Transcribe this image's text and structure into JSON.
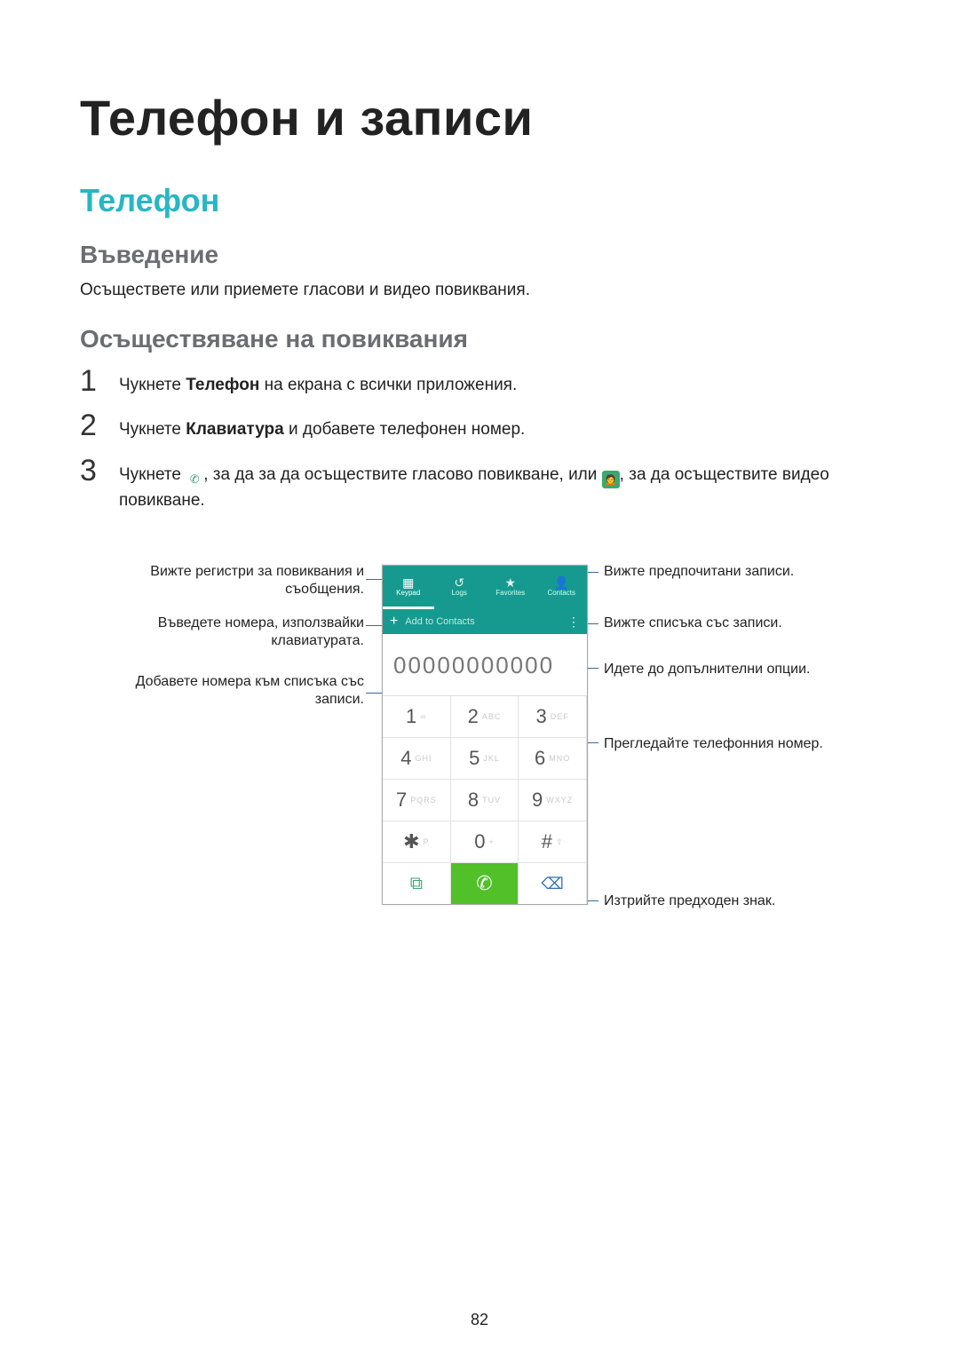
{
  "doc": {
    "title": "Телефон и записи",
    "section": "Телефон",
    "sub1": {
      "heading": "Въведение",
      "body": "Осъществете или приемете гласови и видео повиквания."
    },
    "sub2": {
      "heading": "Осъществяване на повиквания"
    },
    "steps": {
      "s1_pre": "Чукнете ",
      "s1_bold": "Телефон",
      "s1_post": " на екрана с всички приложения.",
      "s2_pre": "Чукнете ",
      "s2_bold": "Клавиатура",
      "s2_post": " и добавете телефонен номер.",
      "s3_pre": "Чукнете ",
      "s3_mid": ", за да за да осъществите гласово повикване, или ",
      "s3_post": ", за да осъществите видео повикване."
    },
    "page_number": "82"
  },
  "callouts": {
    "left1": "Вижте регистри за повиквания и съобщения.",
    "left2": "Въведете номера, използвайки клавиатурата.",
    "left3": "Добавете номера към списъка със записи.",
    "right1": "Вижте предпочитани записи.",
    "right2": "Вижте списъка със записи.",
    "right3": "Идете до допълнителни опции.",
    "right4": "Прегледайте телефонния номер.",
    "right5": "Изтрийте предходен знак."
  },
  "ui": {
    "tabs": {
      "keypad_label": "Keypad",
      "logs_label": "Logs",
      "favorites_label": "Favorites",
      "contacts_label": "Contacts"
    },
    "add_to_contacts": "Add to Contacts",
    "entered_number": "00000000000",
    "keys": {
      "k1": "1",
      "k1s": "∞",
      "k2": "2",
      "k2s": "ABC",
      "k3": "3",
      "k3s": "DEF",
      "k4": "4",
      "k4s": "GHI",
      "k5": "5",
      "k5s": "JKL",
      "k6": "6",
      "k6s": "MNO",
      "k7": "7",
      "k7s": "PQRS",
      "k8": "8",
      "k8s": "TUV",
      "k9": "9",
      "k9s": "WXYZ",
      "ks": "✱",
      "kss": "P",
      "k0": "0",
      "k0s": "+",
      "kh": "#",
      "khs": "⇧"
    }
  },
  "icons": {
    "phone_green": "green-phone-handset",
    "videocall_green": "green-video-person"
  }
}
